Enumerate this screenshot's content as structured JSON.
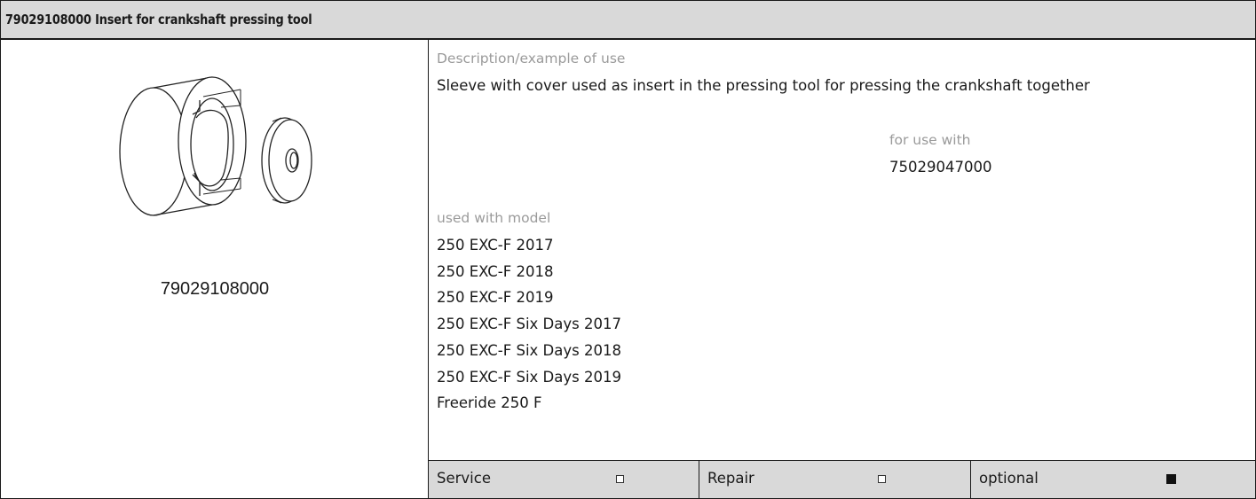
{
  "header": {
    "title": "79029108000 Insert for crankshaft pressing tool"
  },
  "left": {
    "illustration_icon": "sleeve-and-cover-drawing",
    "part_number": "79029108000"
  },
  "right": {
    "description_label": "Description/example of use",
    "description_text": "Sleeve with cover used as insert in the pressing tool for pressing the crankshaft together",
    "for_use_with_label": "for use with",
    "for_use_with_value": "75029047000",
    "models_label": "used with model",
    "models": [
      "250 EXC-F 2017",
      "250 EXC-F 2018",
      "250 EXC-F 2019",
      "250 EXC-F Six Days 2017",
      "250 EXC-F Six Days 2018",
      "250 EXC-F Six Days 2019",
      "Freeride 250 F"
    ]
  },
  "footer": [
    {
      "label": "Service",
      "checked": false
    },
    {
      "label": "Repair",
      "checked": false
    },
    {
      "label": "optional",
      "checked": true
    }
  ]
}
